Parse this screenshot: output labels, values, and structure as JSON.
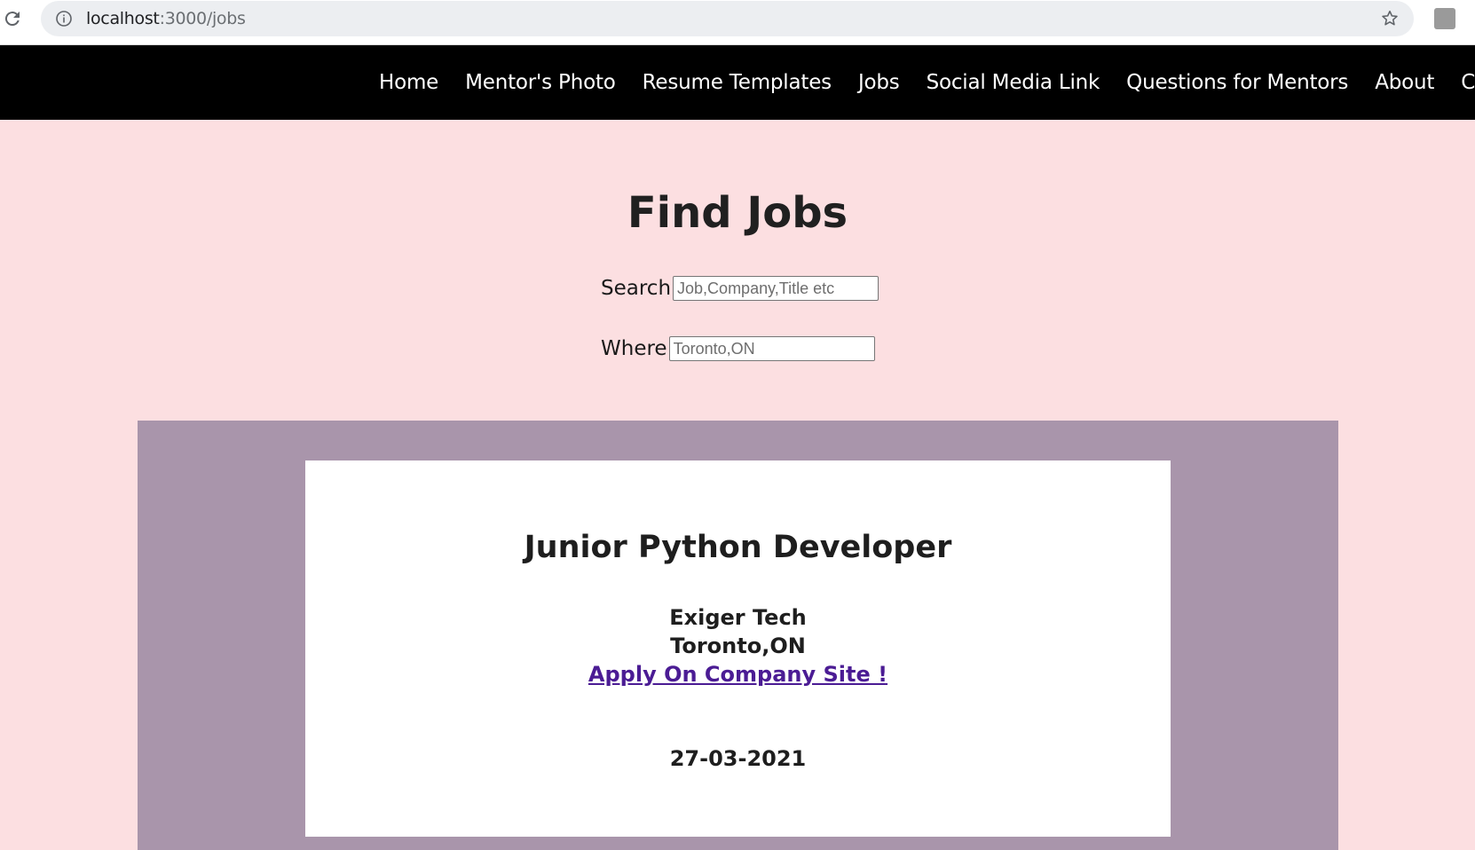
{
  "browser": {
    "url_host": "localhost",
    "url_path": ":3000/jobs"
  },
  "nav": {
    "items": [
      "Home",
      "Mentor's Photo",
      "Resume Templates",
      "Jobs",
      "Social Media Link",
      "Questions for Mentors",
      "About",
      "Conta"
    ]
  },
  "page": {
    "title": "Find Jobs",
    "search": {
      "label": "Search",
      "placeholder": "Job,Company,Title etc"
    },
    "where": {
      "label": "Where",
      "placeholder": "Toronto,ON"
    }
  },
  "jobs": [
    {
      "title": "Junior Python Developer",
      "company": "Exiger Tech",
      "location": "Toronto,ON",
      "apply_label": "Apply On Company Site !",
      "date": "27-03-2021"
    }
  ],
  "colors": {
    "page_bg": "#fcdfe1",
    "navbar_bg": "#000000",
    "panel_bg": "#a995ab",
    "link": "#4b1c94"
  }
}
